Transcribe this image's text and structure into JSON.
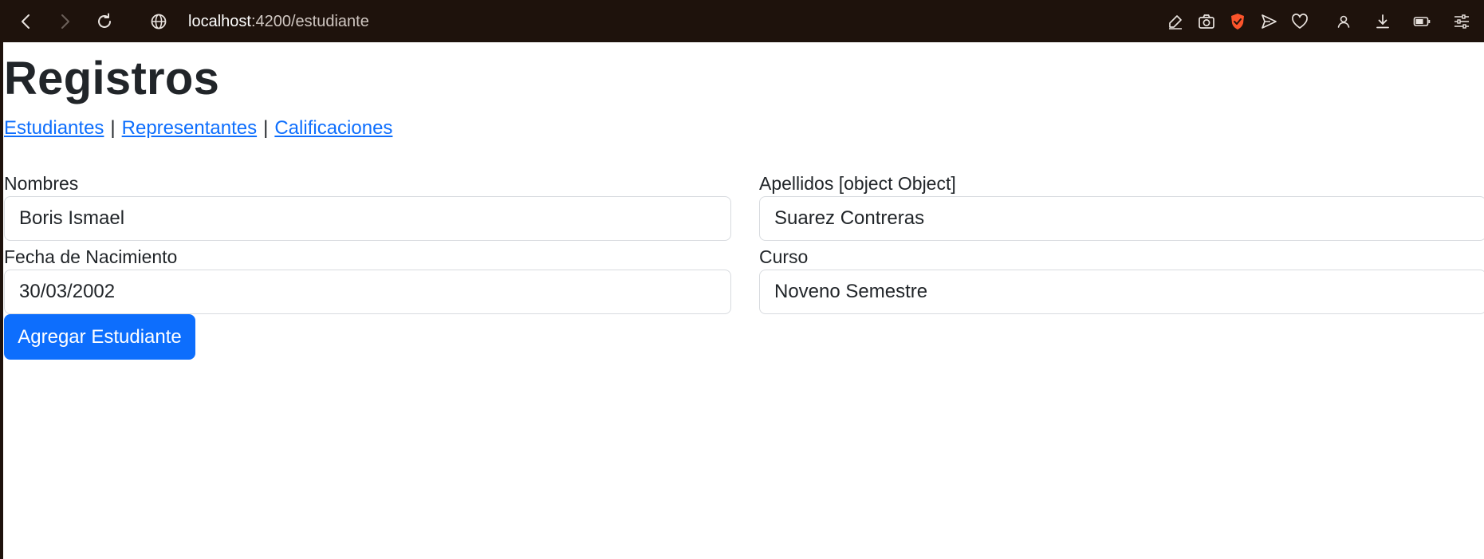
{
  "browser": {
    "url_host": "localhost",
    "url_path": ":4200/estudiante",
    "icons": {
      "back": "back-arrow-icon",
      "forward": "forward-arrow-icon",
      "reload": "reload-icon",
      "site_info": "globe-icon",
      "edit_page": "edit-icon",
      "screenshot": "camera-icon",
      "brave_shield": "shield-icon",
      "send": "send-icon",
      "favorite": "heart-icon",
      "profile": "profile-icon",
      "downloads": "download-icon",
      "battery": "battery-icon",
      "settings": "settings-sliders-icon"
    },
    "colors": {
      "toolbar_bg": "#1e120c",
      "shield": "#fb542b"
    }
  },
  "page": {
    "title": "Registros",
    "nav": {
      "links": [
        "Estudiantes",
        "Representantes",
        "Calificaciones"
      ],
      "separator": "|"
    },
    "form": {
      "nombres": {
        "label": "Nombres",
        "value": "Boris Ismael"
      },
      "apellidos": {
        "label": "Apellidos [object Object]",
        "value": "Suarez Contreras"
      },
      "fecha": {
        "label": "Fecha de Nacimiento",
        "value": "30/03/2002"
      },
      "curso": {
        "label": "Curso",
        "value": "Noveno Semestre"
      },
      "submit_label": "Agregar Estudiante"
    },
    "colors": {
      "link": "#0d6efd",
      "primary_button": "#0d6efd",
      "text": "#212529"
    }
  }
}
